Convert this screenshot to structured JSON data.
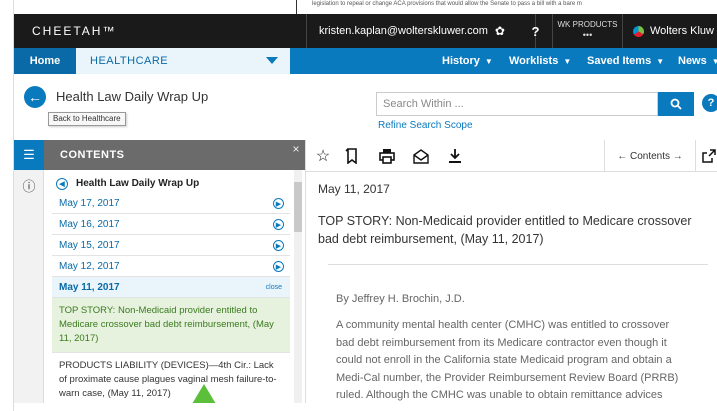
{
  "background": {
    "top_text": "legislation to repeal or change ACA provisions that would allow the Senate to pass a bill with a bare m"
  },
  "header": {
    "brand": "CHEETAH™",
    "user_email": "kristen.kaplan@wolterskluwer.com",
    "help_label": "?",
    "products_label": "WK PRODUCTS",
    "products_dots": "•••",
    "company_label": "Wolters Kluw"
  },
  "nav": {
    "home_label": "Home",
    "section_label": "HEALTHCARE",
    "menus": [
      {
        "label": "History"
      },
      {
        "label": "Worklists"
      },
      {
        "label": "Saved Items"
      },
      {
        "label": "News"
      }
    ]
  },
  "subheader": {
    "doc_title": "Health Law Daily Wrap Up",
    "back_tooltip": "Back to Healthcare",
    "search_placeholder": "Search Within ...",
    "refine_label": "Refine Search Scope",
    "help_label": "?"
  },
  "contents": {
    "header": "CONTENTS",
    "close_label": "×",
    "title": "Health Law Daily Wrap Up",
    "dates": [
      {
        "label": "May 17, 2017"
      },
      {
        "label": "May 16, 2017"
      },
      {
        "label": "May 15, 2017"
      },
      {
        "label": "May 12, 2017"
      }
    ],
    "active_date": "May 11, 2017",
    "active_close": "close",
    "story": "TOP STORY: Non-Medicaid provider entitled to Medicare crossover bad debt reimbursement, (May 11, 2017)",
    "item": "PRODUCTS LIABILITY (DEVICES)—4th Cir.: Lack of proximate cause plagues vaginal mesh failure-to-warn case, (May 11, 2017)"
  },
  "toolbar": {
    "contents_nav": "← Contents →"
  },
  "document": {
    "date": "May 11, 2017",
    "headline": "TOP STORY: Non-Medicaid provider entitled to Medicare crossover bad debt reimbursement, (May 11, 2017)",
    "author": "By Jeffrey H. Brochin, J.D.",
    "paragraph": "A community mental health center (CMHC) was entitled to crossover bad debt reimbursement from its Medicare contractor even though it could not enroll in the California state Medicaid program and obtain a Medi-Cal number, the Provider Reimbursement Review Board (PRRB) ruled. Although the CMHC was unable to obtain remittance advices"
  },
  "colors": {
    "brand_blue": "#0a7abf",
    "header_black": "#1a1a1a",
    "story_green": "#3a7a1f",
    "arrow_green": "#5bbf3a"
  }
}
